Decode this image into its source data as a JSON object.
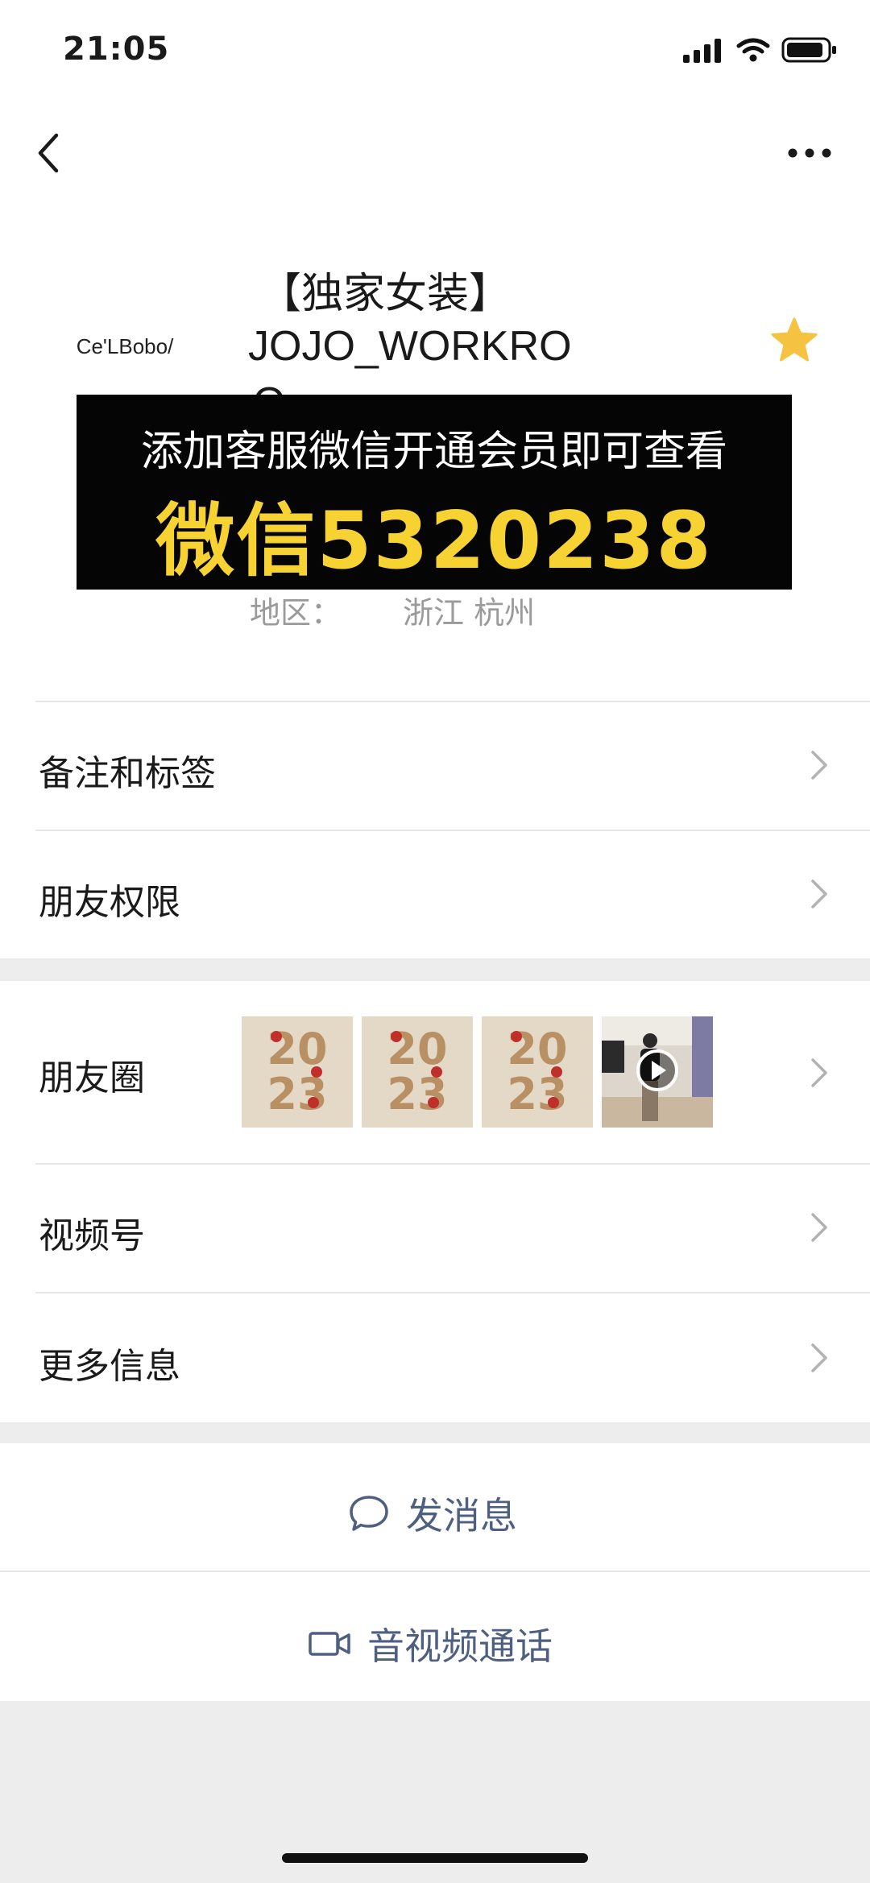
{
  "status_bar": {
    "time": "21:05",
    "icons": [
      "signal-icon",
      "wifi-icon",
      "battery-icon"
    ]
  },
  "nav": {
    "back_icon": "chevron-left-icon",
    "more_icon": "more-dots-icon"
  },
  "profile": {
    "avatar_text": "Ce'LBobo/",
    "name_line1": "【独家女装】",
    "name_line2": "JOJO_WORKRO",
    "name_line3": "O",
    "star_color": "#f5c242",
    "region_label": "地区：",
    "region_value": "浙江 杭州"
  },
  "overlay": {
    "line1": "添加客服微信开通会员即可查看",
    "line2": "微信5320238",
    "background": "#050505",
    "highlight_color": "#f7d233"
  },
  "rows": {
    "remarks": "备注和标签",
    "permissions": "朋友权限",
    "moments": "朋友圈",
    "channels": "视频号",
    "more_info": "更多信息"
  },
  "moments_thumbs": [
    {
      "kind": "image",
      "year_top": "20",
      "year_bottom": "23"
    },
    {
      "kind": "image",
      "year_top": "20",
      "year_bottom": "23"
    },
    {
      "kind": "image",
      "year_top": "20",
      "year_bottom": "23"
    },
    {
      "kind": "video"
    }
  ],
  "actions": {
    "message": "发消息",
    "call": "音视频通话",
    "accent": "#4f5f82"
  }
}
